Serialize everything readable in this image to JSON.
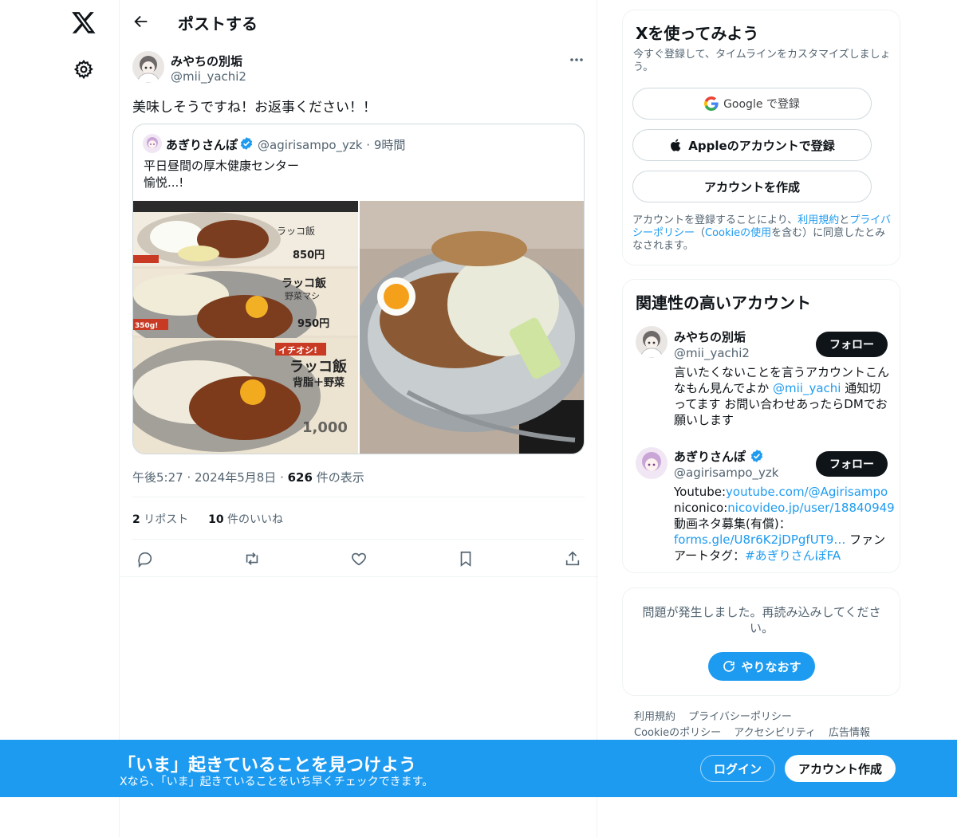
{
  "header": {
    "title": "ポストする"
  },
  "tweet": {
    "author_name": "みやちの別垢",
    "author_handle": "@mii_yachi2",
    "text": "美味しそうですね！お返事ください！！",
    "time": "午後5:27",
    "date": "2024年5月8日",
    "views_count": "626",
    "views_label": "件の表示",
    "reposts_count": "2",
    "reposts_label": "リポスト",
    "likes_count": "10",
    "likes_label": "件のいいね"
  },
  "quote": {
    "author_name": "あぎりさんぽ",
    "author_handle": "@agirisampo_yzk",
    "age": "9時間",
    "line1": "平日昼間の厚木健康センター",
    "line2": "愉悦...!"
  },
  "menu_photo": {
    "price1": "850円",
    "name2": "ラッコ飯",
    "sub2": "野菜マシ",
    "price2": "950円",
    "tag3": "イチオシ!",
    "name3": "ラッコ飯",
    "sub3": "背脂＋野菜",
    "price3": "1,000",
    "weight": "350g!"
  },
  "signup": {
    "title": "Xを使ってみよう",
    "subtitle": "今すぐ登録して、タイムラインをカスタマイズしましょう。",
    "google_label": "Google で登録",
    "apple_label": "Appleのアカウントで登録",
    "create_label": "アカウントを作成",
    "legal_1": "アカウントを登録することにより、",
    "legal_terms": "利用規約",
    "legal_and": "と",
    "legal_privacy": "プライバシーポリシー",
    "legal_paren_open": "（",
    "legal_cookie": "Cookieの使用",
    "legal_2": "を含む）に同意したとみなされます。"
  },
  "related": {
    "title": "関連性の高いアカウント",
    "follow_label": "フォロー",
    "accounts": [
      {
        "name": "みやちの別垢",
        "handle": "@mii_yachi2",
        "bio_1": "言いたくないことを言うアカウントこんなもん見んでよか ",
        "bio_link": "@mii_yachi",
        "bio_2": " 通知切ってます お問い合わせあったらDMでお願いします"
      },
      {
        "name": "あぎりさんぽ",
        "handle": "@agirisampo_yzk",
        "yt_label": "Youtube:",
        "yt_link": "youtube.com/@Agirisampo",
        "nico_label": "niconico:",
        "nico_link": "nicovideo.jp/user/18840949",
        "bio_mid": "動画ネタ募集(有償)：",
        "forms_link": "forms.gle/U8r6K2jDPgfUT9…",
        "bio_tail": " ファンアートタグ：",
        "tag_link": "#あぎりさんぽFA"
      }
    ]
  },
  "error_box": {
    "message": "問題が発生しました。再読み込みしてください。",
    "retry_label": "やりなおす"
  },
  "footer": {
    "links": [
      "利用規約",
      "プライバシーポリシー",
      "Cookieのポリシー",
      "アクセシビリティ",
      "広告情報"
    ]
  },
  "banner": {
    "title": "「いま」起きていることを見つけよう",
    "subtitle": "Xなら、「いま」起きていることをいち早くチェックできます。",
    "login_label": "ログイン",
    "signup_label": "アカウント作成"
  },
  "colors": {
    "accent": "#1d9bf0",
    "text": "#0f1419",
    "muted": "#536471",
    "border": "#eff3f4"
  }
}
